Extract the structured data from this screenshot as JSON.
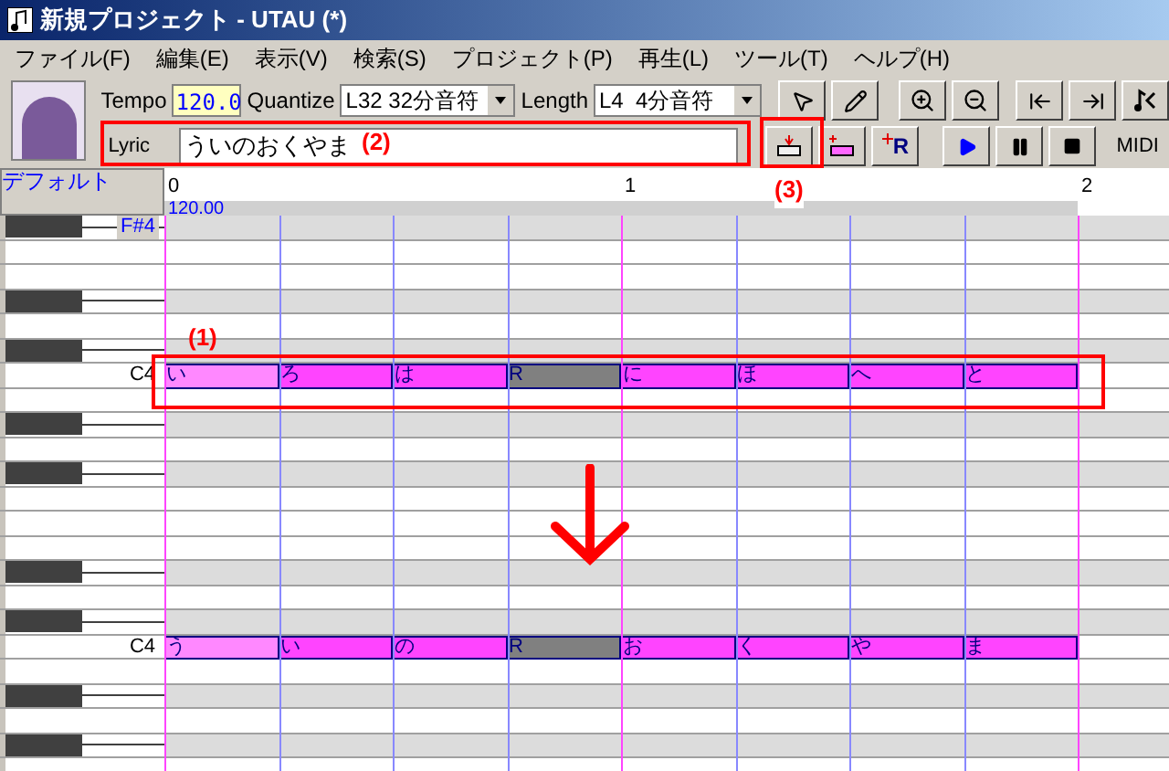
{
  "window": {
    "title": "新規プロジェクト - UTAU (*)"
  },
  "menu": [
    "ファイル(F)",
    "編集(E)",
    "表示(V)",
    "検索(S)",
    "プロジェクト(P)",
    "再生(L)",
    "ツール(T)",
    "ヘルプ(H)"
  ],
  "toolbar": {
    "tempo_label": "Tempo",
    "tempo": "120.0",
    "quantize_label": "Quantize",
    "quantize": "L32 32分音符",
    "length_label": "Length",
    "length": "L4  4分音符",
    "lyric_label": "Lyric",
    "lyric": "ういのおくやま",
    "rest_button": "R",
    "midi_label": "MIDI"
  },
  "track": {
    "name": "デフォルト",
    "ruler": [
      "0",
      "1",
      "2"
    ],
    "tempo_marker": "120.00"
  },
  "roll_before": {
    "rows": [
      {
        "kind": "black",
        "label": "F#4",
        "label_highlighted": true
      },
      {
        "kind": "white"
      },
      {
        "kind": "white"
      },
      {
        "kind": "black"
      },
      {
        "kind": "white"
      },
      {
        "kind": "black"
      },
      {
        "kind": "white",
        "label": "C4",
        "label_highlighted": false,
        "notes": [
          {
            "lyric": "い",
            "kind": "light"
          },
          {
            "lyric": "ろ",
            "kind": "normal"
          },
          {
            "lyric": "は",
            "kind": "normal"
          },
          {
            "lyric": "R",
            "kind": "rest"
          },
          {
            "lyric": "に",
            "kind": "normal"
          },
          {
            "lyric": "ほ",
            "kind": "normal"
          },
          {
            "lyric": "へ",
            "kind": "normal"
          },
          {
            "lyric": "と",
            "kind": "normal"
          }
        ]
      },
      {
        "kind": "white"
      },
      {
        "kind": "black"
      },
      {
        "kind": "white"
      },
      {
        "kind": "black"
      },
      {
        "kind": "white"
      }
    ]
  },
  "roll_after": {
    "rows": [
      {
        "kind": "white"
      },
      {
        "kind": "white"
      },
      {
        "kind": "black"
      },
      {
        "kind": "white"
      },
      {
        "kind": "black"
      },
      {
        "kind": "white",
        "label": "C4",
        "label_highlighted": false,
        "notes": [
          {
            "lyric": "う",
            "kind": "light"
          },
          {
            "lyric": "い",
            "kind": "normal"
          },
          {
            "lyric": "の",
            "kind": "normal"
          },
          {
            "lyric": "R",
            "kind": "rest"
          },
          {
            "lyric": "お",
            "kind": "normal"
          },
          {
            "lyric": "く",
            "kind": "normal"
          },
          {
            "lyric": "や",
            "kind": "normal"
          },
          {
            "lyric": "ま",
            "kind": "normal"
          }
        ]
      },
      {
        "kind": "white"
      },
      {
        "kind": "black"
      },
      {
        "kind": "white"
      },
      {
        "kind": "black"
      },
      {
        "kind": "white"
      }
    ]
  },
  "annotations": [
    "(1)",
    "(2)",
    "(3)"
  ]
}
